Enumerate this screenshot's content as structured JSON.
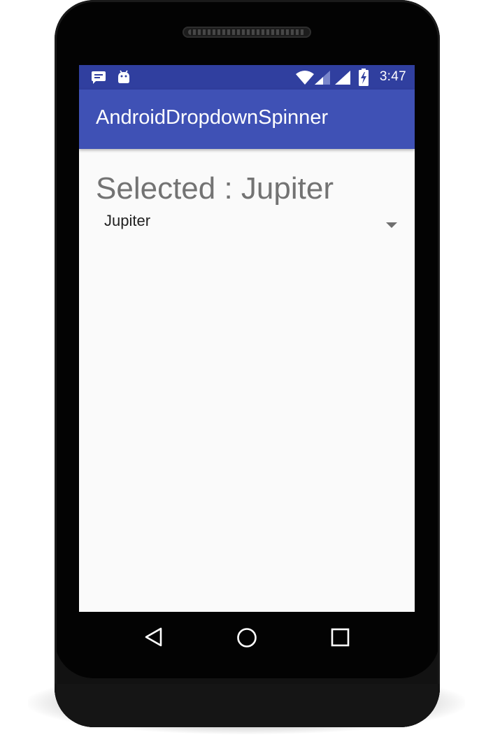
{
  "status_bar": {
    "time": "3:47",
    "left_icons": [
      "message-icon",
      "android-debug-icon"
    ],
    "right_icons": [
      "wifi-icon",
      "cellular-signal-icon",
      "cellular-signal-icon",
      "battery-charging-icon"
    ]
  },
  "app_bar": {
    "title": "AndroidDropdownSpinner"
  },
  "content": {
    "selected_text": "Selected : Jupiter",
    "spinner": {
      "value": "Jupiter",
      "icon": "dropdown-arrow-icon"
    }
  },
  "nav_bar": {
    "icons": [
      "back-icon",
      "home-icon",
      "recents-icon"
    ]
  },
  "colors": {
    "status_bar": "#303f9f",
    "app_bar": "#3f51b5",
    "background": "#fafafa",
    "selected_text": "#737373",
    "spinner_text": "#212121"
  }
}
